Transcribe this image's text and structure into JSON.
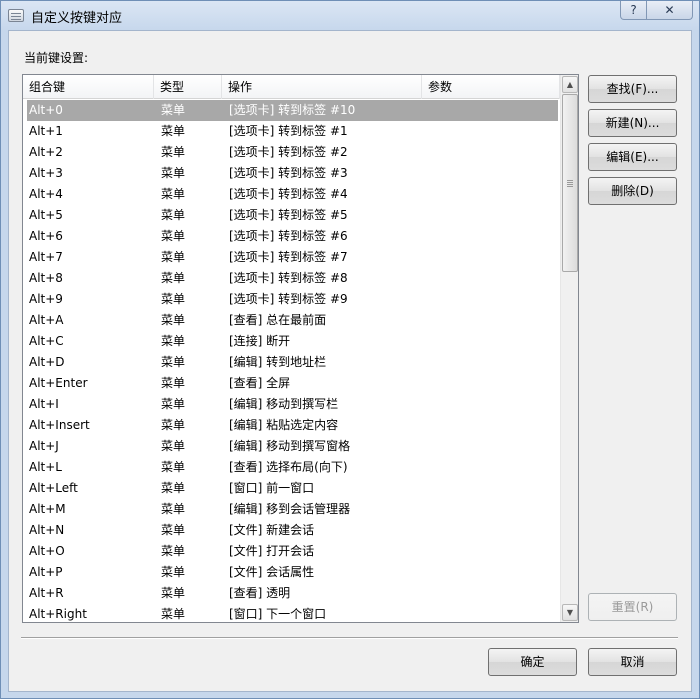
{
  "window": {
    "title": "自定义按键对应",
    "help_label": "?",
    "close_label": "✕"
  },
  "section_label": "当前键设置:",
  "table": {
    "columns": [
      "组合键",
      "类型",
      "操作",
      "参数"
    ],
    "selected_index": 0,
    "rows": [
      {
        "key": "Alt+0",
        "type": "菜单",
        "action": "[选项卡] 转到标签 #10",
        "param": ""
      },
      {
        "key": "Alt+1",
        "type": "菜单",
        "action": "[选项卡] 转到标签 #1",
        "param": ""
      },
      {
        "key": "Alt+2",
        "type": "菜单",
        "action": "[选项卡] 转到标签 #2",
        "param": ""
      },
      {
        "key": "Alt+3",
        "type": "菜单",
        "action": "[选项卡] 转到标签 #3",
        "param": ""
      },
      {
        "key": "Alt+4",
        "type": "菜单",
        "action": "[选项卡] 转到标签 #4",
        "param": ""
      },
      {
        "key": "Alt+5",
        "type": "菜单",
        "action": "[选项卡] 转到标签 #5",
        "param": ""
      },
      {
        "key": "Alt+6",
        "type": "菜单",
        "action": "[选项卡] 转到标签 #6",
        "param": ""
      },
      {
        "key": "Alt+7",
        "type": "菜单",
        "action": "[选项卡] 转到标签 #7",
        "param": ""
      },
      {
        "key": "Alt+8",
        "type": "菜单",
        "action": "[选项卡] 转到标签 #8",
        "param": ""
      },
      {
        "key": "Alt+9",
        "type": "菜单",
        "action": "[选项卡] 转到标签 #9",
        "param": ""
      },
      {
        "key": "Alt+A",
        "type": "菜单",
        "action": "[查看] 总在最前面",
        "param": ""
      },
      {
        "key": "Alt+C",
        "type": "菜单",
        "action": "[连接] 断开",
        "param": ""
      },
      {
        "key": "Alt+D",
        "type": "菜单",
        "action": "[编辑] 转到地址栏",
        "param": ""
      },
      {
        "key": "Alt+Enter",
        "type": "菜单",
        "action": "[查看] 全屏",
        "param": ""
      },
      {
        "key": "Alt+I",
        "type": "菜单",
        "action": "[编辑] 移动到撰写栏",
        "param": ""
      },
      {
        "key": "Alt+Insert",
        "type": "菜单",
        "action": "[编辑] 粘贴选定内容",
        "param": ""
      },
      {
        "key": "Alt+J",
        "type": "菜单",
        "action": "[编辑] 移动到撰写窗格",
        "param": ""
      },
      {
        "key": "Alt+L",
        "type": "菜单",
        "action": "[查看] 选择布局(向下)",
        "param": ""
      },
      {
        "key": "Alt+Left",
        "type": "菜单",
        "action": "[窗口] 前一窗口",
        "param": ""
      },
      {
        "key": "Alt+M",
        "type": "菜单",
        "action": "[编辑] 移到会话管理器",
        "param": ""
      },
      {
        "key": "Alt+N",
        "type": "菜单",
        "action": "[文件] 新建会话",
        "param": ""
      },
      {
        "key": "Alt+O",
        "type": "菜单",
        "action": "[文件] 打开会话",
        "param": ""
      },
      {
        "key": "Alt+P",
        "type": "菜单",
        "action": "[文件] 会话属性",
        "param": ""
      },
      {
        "key": "Alt+R",
        "type": "菜单",
        "action": "[查看] 透明",
        "param": ""
      },
      {
        "key": "Alt+Right",
        "type": "菜单",
        "action": "[窗口] 下一个窗口",
        "param": ""
      }
    ]
  },
  "buttons": {
    "find": "查找(F)...",
    "new": "新建(N)...",
    "edit": "编辑(E)...",
    "delete": "删除(D)",
    "reset": "重置(R)",
    "ok": "确定",
    "cancel": "取消"
  },
  "icons": {
    "scroll_up": "▲",
    "scroll_down": "▼"
  },
  "colors": {
    "selection": "#a8a8a8",
    "window_frame": "#c6d7ec"
  }
}
